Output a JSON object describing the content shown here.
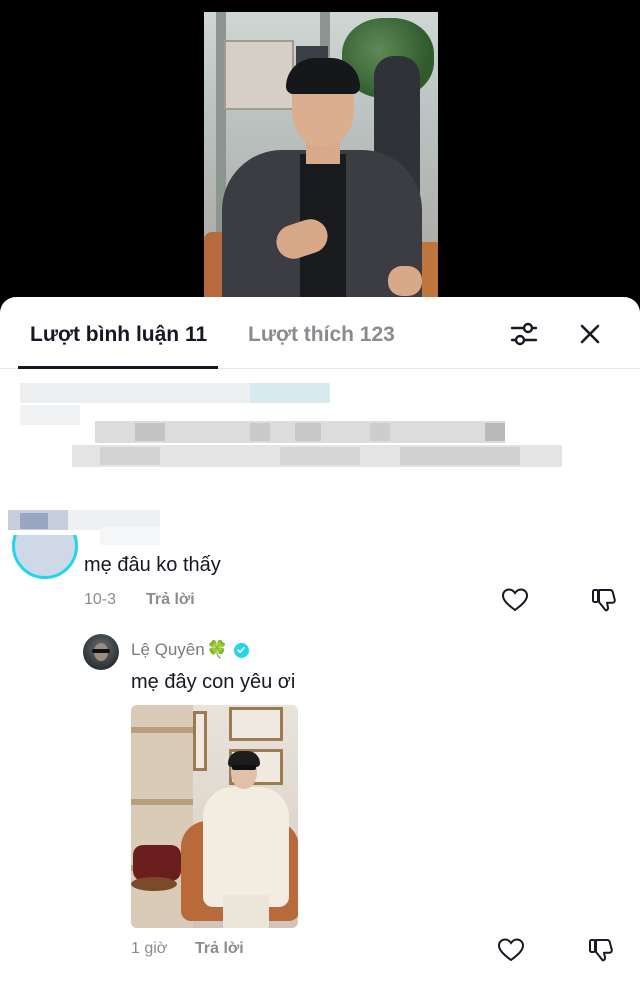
{
  "tabs": {
    "comments_label": "Lượt bình luận 11",
    "likes_label": "Lượt thích 123"
  },
  "comment1": {
    "text": "mẹ đâu ko thấy",
    "date": "10-3",
    "reply_label": "Trả lời"
  },
  "reply1": {
    "username": "Lệ Quyên",
    "emoji": "🍀",
    "text": "mẹ đây con yêu ơi",
    "time": "1 giờ",
    "reply_label": "Trả lời"
  },
  "colors": {
    "text_primary": "#161823",
    "text_secondary": "#8a8b91",
    "verified": "#20d5ec",
    "story_ring": "#20d5ec"
  },
  "icons": [
    "filter-icon",
    "close-icon",
    "heart-icon",
    "dislike-icon",
    "verified-badge-icon"
  ]
}
